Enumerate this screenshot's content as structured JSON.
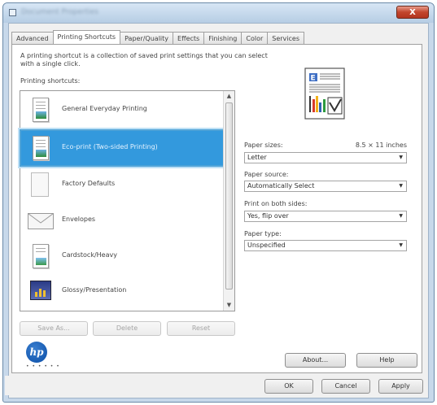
{
  "window": {
    "title": "Document Properties",
    "close_label": "X"
  },
  "tabs": [
    {
      "label": "Advanced"
    },
    {
      "label": "Printing Shortcuts"
    },
    {
      "label": "Paper/Quality"
    },
    {
      "label": "Effects"
    },
    {
      "label": "Finishing"
    },
    {
      "label": "Color"
    },
    {
      "label": "Services"
    }
  ],
  "active_tab": "Printing Shortcuts",
  "description": "A printing shortcut is a collection of saved print settings that you can select with a single click.",
  "shortcuts_label": "Printing shortcuts:",
  "shortcuts": [
    {
      "label": "General Everyday Printing",
      "icon": "document-photo-icon"
    },
    {
      "label": "Eco-print (Two-sided Printing)",
      "icon": "document-photo-icon",
      "selected": true
    },
    {
      "label": "Factory Defaults",
      "icon": "blank-page-icon"
    },
    {
      "label": "Envelopes",
      "icon": "envelope-icon"
    },
    {
      "label": "Cardstock/Heavy",
      "icon": "document-photo-icon"
    },
    {
      "label": "Glossy/Presentation",
      "icon": "presentation-icon"
    }
  ],
  "list_buttons": {
    "save_as": "Save As...",
    "delete": "Delete",
    "reset": "Reset"
  },
  "settings": {
    "paper_size_label": "Paper sizes:",
    "paper_size_dims": "8.5 × 11 inches",
    "paper_size_value": "Letter",
    "paper_source_label": "Paper source:",
    "paper_source_value": "Automatically Select",
    "duplex_label": "Print on both sides:",
    "duplex_value": "Yes, flip over",
    "paper_type_label": "Paper type:",
    "paper_type_value": "Unspecified"
  },
  "brand": {
    "logo_text": "hp",
    "dots": "• • • • • •"
  },
  "footer_buttons": {
    "about": "About...",
    "help": "Help",
    "ok": "OK",
    "cancel": "Cancel",
    "apply": "Apply"
  },
  "colors": {
    "selection": "#3399dd",
    "window_frame": "#c7d8ea",
    "close_button": "#c2452d"
  }
}
